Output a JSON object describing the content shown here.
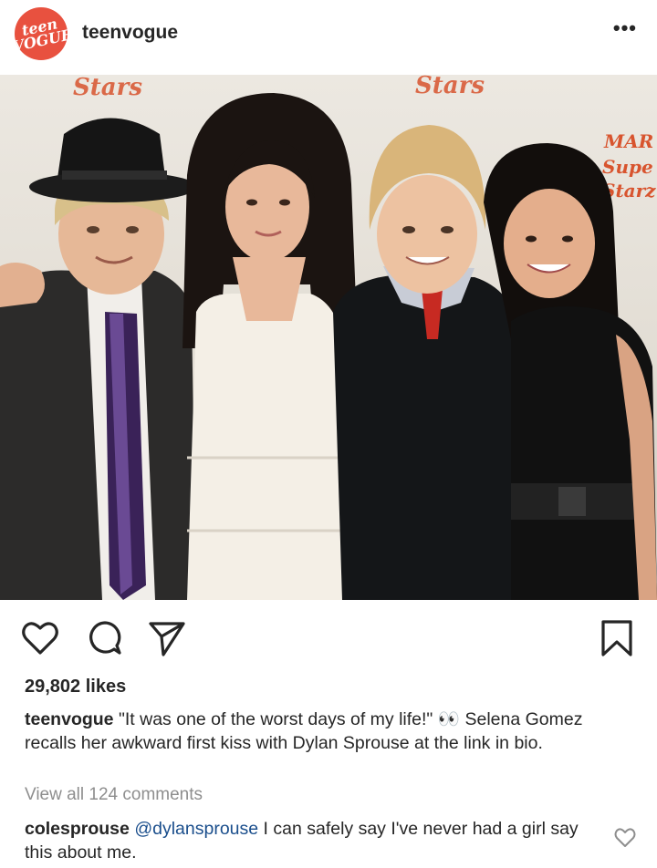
{
  "account": {
    "avatar_text": "teen VOGUE",
    "username": "teenvogue",
    "more_label": "•••"
  },
  "photo": {
    "backdrop_text": "Stars",
    "backdrop_text_2": "MAR Super Stars"
  },
  "icons": {
    "like": "heart-outline-icon",
    "comment": "comment-bubble-icon",
    "share": "paper-plane-icon",
    "save": "bookmark-icon",
    "comment_like": "small-heart-icon"
  },
  "post": {
    "likes": "29,802 likes",
    "caption_user": "teenvogue",
    "caption_text_1": " \"It was one of the worst days of my life!\" ",
    "caption_emoji": "👀",
    "caption_text_2": " Selena Gomez recalls her awkward first kiss with Dylan Sprouse at the link in bio.",
    "view_all": "View all 124 comments"
  },
  "comment": {
    "user": "colesprouse",
    "mention": "@dylansprouse",
    "text": " I can safely say I've never had a girl say this about me."
  }
}
